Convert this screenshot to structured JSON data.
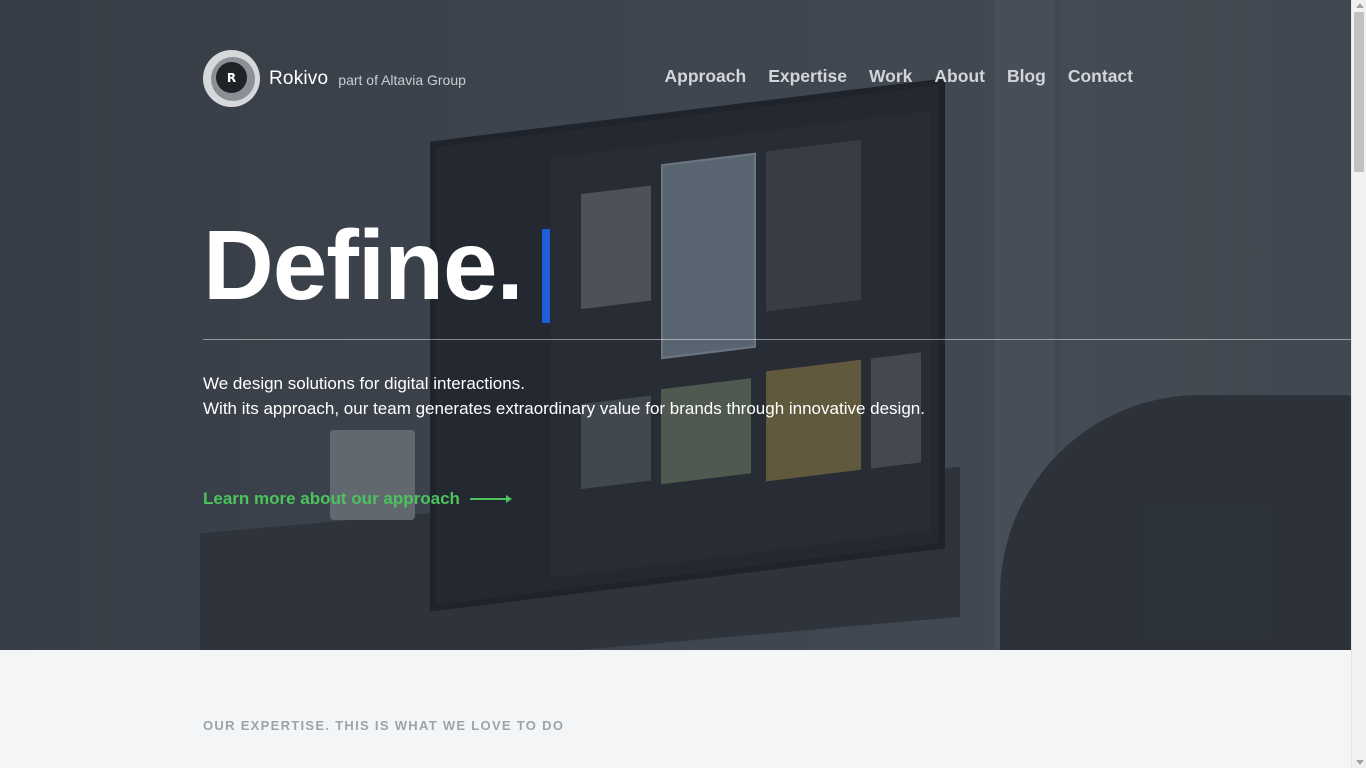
{
  "header": {
    "logo_letter": "R",
    "brand_name": "Rokivo",
    "brand_tagline": "part of Altavia Group",
    "nav": [
      {
        "label": "Approach"
      },
      {
        "label": "Expertise"
      },
      {
        "label": "Work"
      },
      {
        "label": "About"
      },
      {
        "label": "Blog"
      },
      {
        "label": "Contact"
      }
    ]
  },
  "hero": {
    "headline": "Define.",
    "intro_line1": "We design solutions for digital interactions.",
    "intro_line2": "With its approach, our team generates extraordinary value for brands through innovative design.",
    "cta_label": "Learn more about our approach",
    "accent_color": "#4cc35c",
    "cursor_color": "#1f5fd6"
  },
  "expertise": {
    "section_title": "OUR EXPERTISE. THIS IS WHAT WE LOVE TO DO"
  }
}
